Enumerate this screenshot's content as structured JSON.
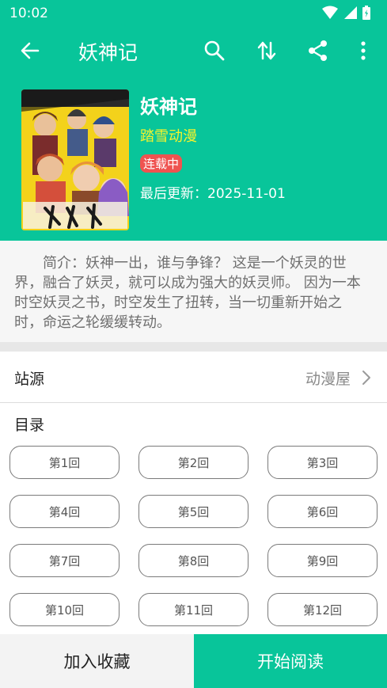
{
  "status_bar": {
    "time": "10:02"
  },
  "app_bar": {
    "title": "妖神记",
    "icons": [
      "back-arrow-icon",
      "search-icon",
      "sort-icon",
      "share-icon",
      "more-vert-icon"
    ]
  },
  "comic": {
    "title": "妖神记",
    "author": "踏雪动漫",
    "status": "连载中",
    "last_update": "最后更新：2025-11-01"
  },
  "description": "简介：妖神一出，谁与争锋？ 这是一个妖灵的世界，融合了妖灵，就可以成为强大的妖灵师。 因为一本时空妖灵之书，时空发生了扭转，当一切重新开始之时，命运之轮缓缓转动。",
  "source": {
    "label": "站源",
    "value": "动漫屋"
  },
  "toc": {
    "title": "目录",
    "chapters": [
      "第1回",
      "第2回",
      "第3回",
      "第4回",
      "第5回",
      "第6回",
      "第7回",
      "第8回",
      "第9回",
      "第10回",
      "第11回",
      "第12回"
    ]
  },
  "actions": {
    "favorite": "加入收藏",
    "read": "开始阅读"
  },
  "colors": {
    "accent": "#08c59a",
    "author": "#f6f32c",
    "status_badge": "#ef5350"
  }
}
